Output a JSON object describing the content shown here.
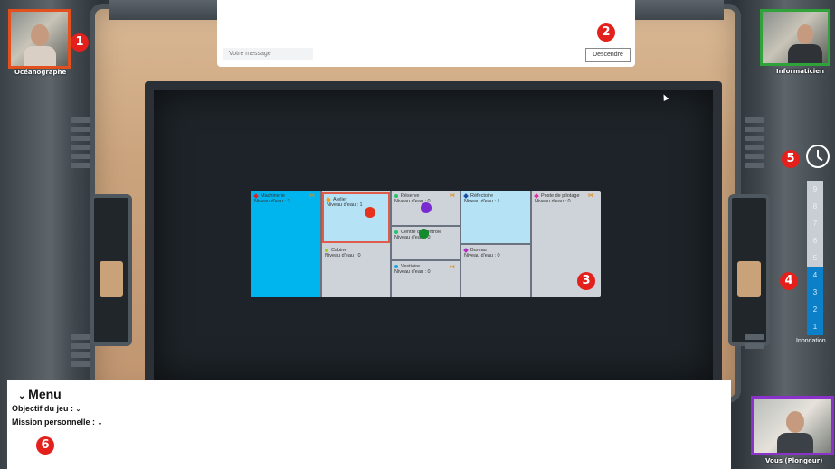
{
  "participants": {
    "top_left": {
      "label": "Océanographe",
      "marker": "1",
      "border_color": "#e2501f"
    },
    "top_right": {
      "label": "Informaticien",
      "border_color": "#2fa33a"
    },
    "bottom_right": {
      "label": "Vous (Plongeur)",
      "border_color": "#8a32c9"
    }
  },
  "chat": {
    "input_placeholder": "Votre message",
    "button_label": "Descendre",
    "marker": "2"
  },
  "map": {
    "marker": "3",
    "rooms": [
      {
        "name": "Machinerie",
        "level": "Niveau d'eau : 3",
        "icon_color": "#e32020",
        "fill": "#00b5ee"
      },
      {
        "name": "Atelier",
        "level": "Niveau d'eau : 1",
        "icon_color": "#f0a020",
        "fill": "#b5e2f5"
      },
      {
        "name": "Cabine",
        "level": "Niveau d'eau : 0",
        "icon_color": "#9ad020",
        "fill": "#ced3d9"
      },
      {
        "name": "Réserve",
        "level": "Niveau d'eau : 0",
        "icon_color": "#27c46a",
        "fill": "#ced3d9"
      },
      {
        "name": "Centre de contrôle",
        "level": "Niveau d'eau : 0",
        "icon_color": "#27c46a",
        "fill": "#ced3d9"
      },
      {
        "name": "Vestiaire",
        "level": "Niveau d'eau : 0",
        "icon_color": "#1aa4e0",
        "fill": "#ced3d9"
      },
      {
        "name": "Réfectoire",
        "level": "Niveau d'eau : 1",
        "icon_color": "#1a4fa0",
        "fill": "#b5e2f5"
      },
      {
        "name": "Bureau",
        "level": "Niveau d'eau : 0",
        "icon_color": "#b030c0",
        "fill": "#ced3d9"
      },
      {
        "name": "Poste de pilotage",
        "level": "Niveau d'eau : 0",
        "icon_color": "#e030a0",
        "fill": "#ced3d9"
      }
    ]
  },
  "flood": {
    "marker_timer": "5",
    "marker_gauge": "4",
    "levels": [
      "9",
      "8",
      "7",
      "6",
      "5",
      "4",
      "3",
      "2",
      "1"
    ],
    "current": 4,
    "label": "Inondation"
  },
  "menu": {
    "title": "Menu",
    "objective_label": "Objectif du jeu :",
    "mission_label": "Mission personnelle :",
    "marker": "6"
  }
}
